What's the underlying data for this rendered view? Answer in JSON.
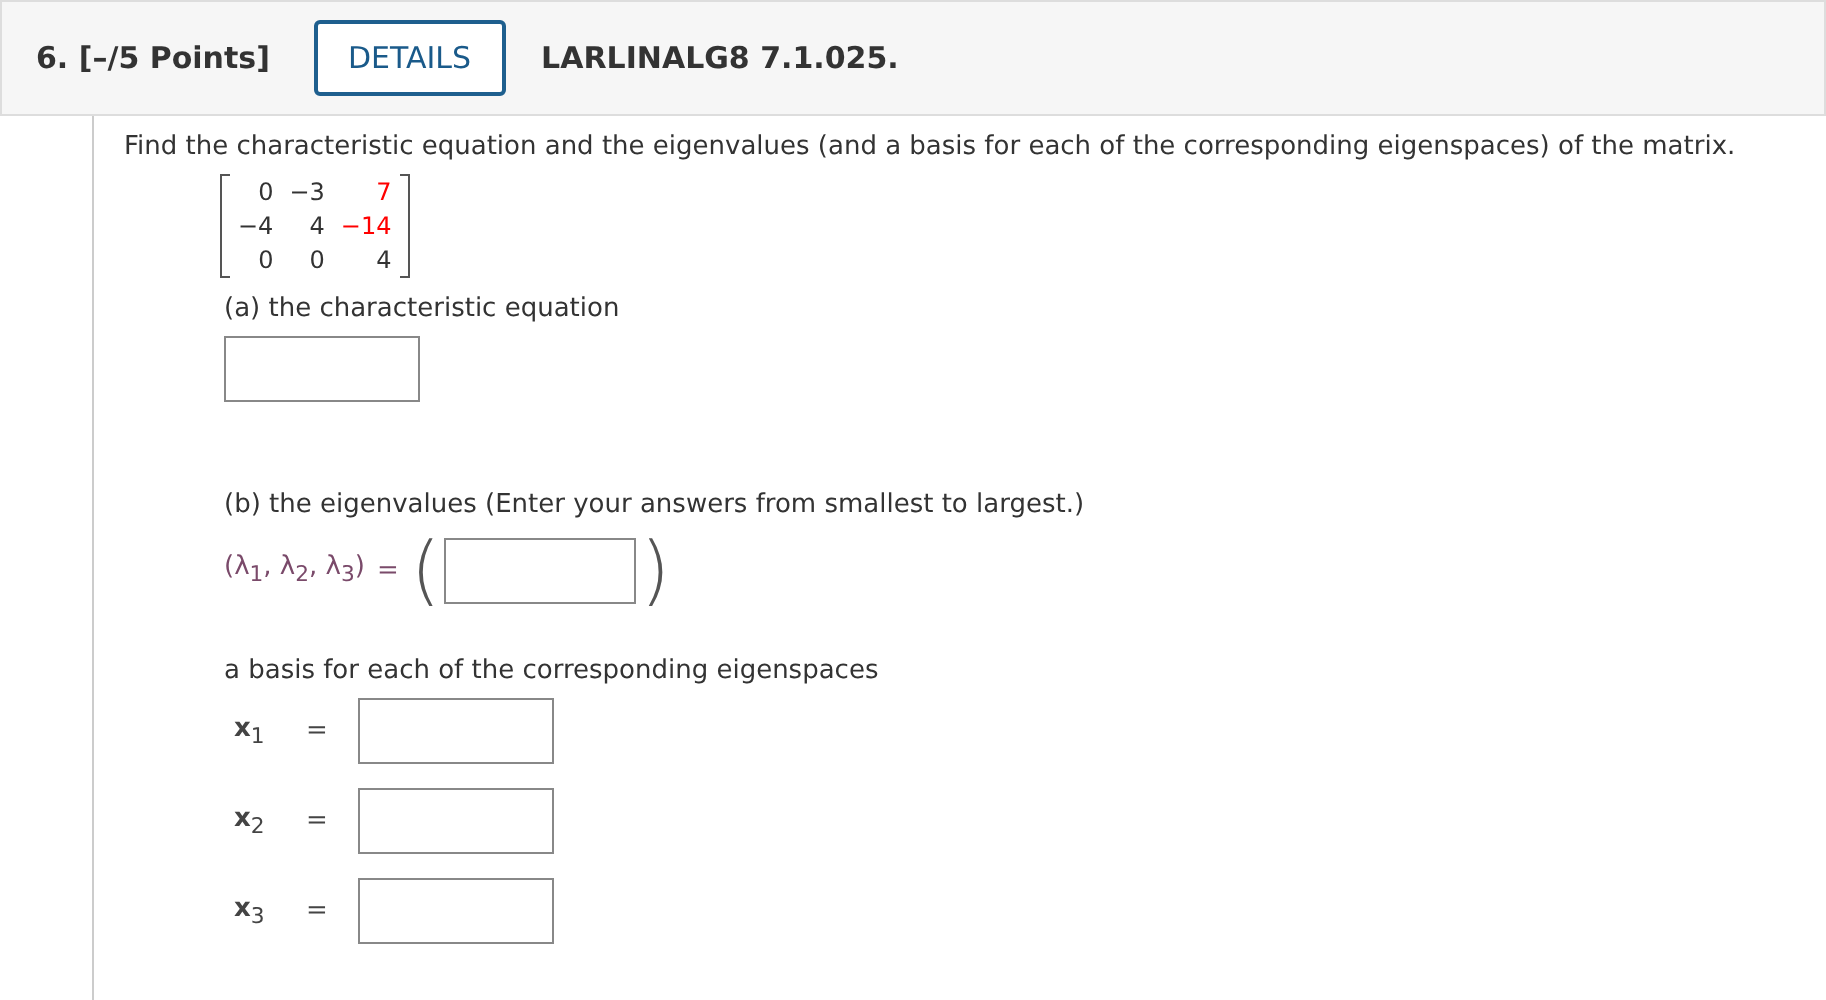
{
  "question": {
    "number": "6.",
    "points": "[–/5 Points]",
    "details_button": "DETAILS",
    "code": "LARLINALG8 7.1.025."
  },
  "prompt": "Find the characteristic equation and the eigenvalues (and a basis for each of the corresponding eigenspaces) of the matrix.",
  "matrix": [
    [
      {
        "value": "0",
        "color": "#333333"
      },
      {
        "value": "−3",
        "color": "#333333"
      },
      {
        "value": "7",
        "color": "#ff0000"
      }
    ],
    [
      {
        "value": "−4",
        "color": "#333333"
      },
      {
        "value": "4",
        "color": "#333333"
      },
      {
        "value": "−14",
        "color": "#ff0000"
      }
    ],
    [
      {
        "value": "0",
        "color": "#333333"
      },
      {
        "value": "0",
        "color": "#333333"
      },
      {
        "value": "4",
        "color": "#333333"
      }
    ]
  ],
  "part_a": {
    "label": "(a) the characteristic equation"
  },
  "part_b": {
    "label": "(b) the eigenvalues (Enter your answers from smallest to largest.)",
    "tuple_label": "(λ$_{1}$, λ$_{2}$, λ$_{3}$)",
    "equals": "=",
    "open_paren": "(",
    "close_paren": ")"
  },
  "basis": {
    "label": "a basis for each of the corresponding eigenspaces",
    "vectors": [
      {
        "name": "**x**$_{1}$",
        "equals": "="
      },
      {
        "name": "**x**$_{2}$",
        "equals": "="
      },
      {
        "name": "**x**$_{3}$",
        "equals": "="
      }
    ]
  }
}
